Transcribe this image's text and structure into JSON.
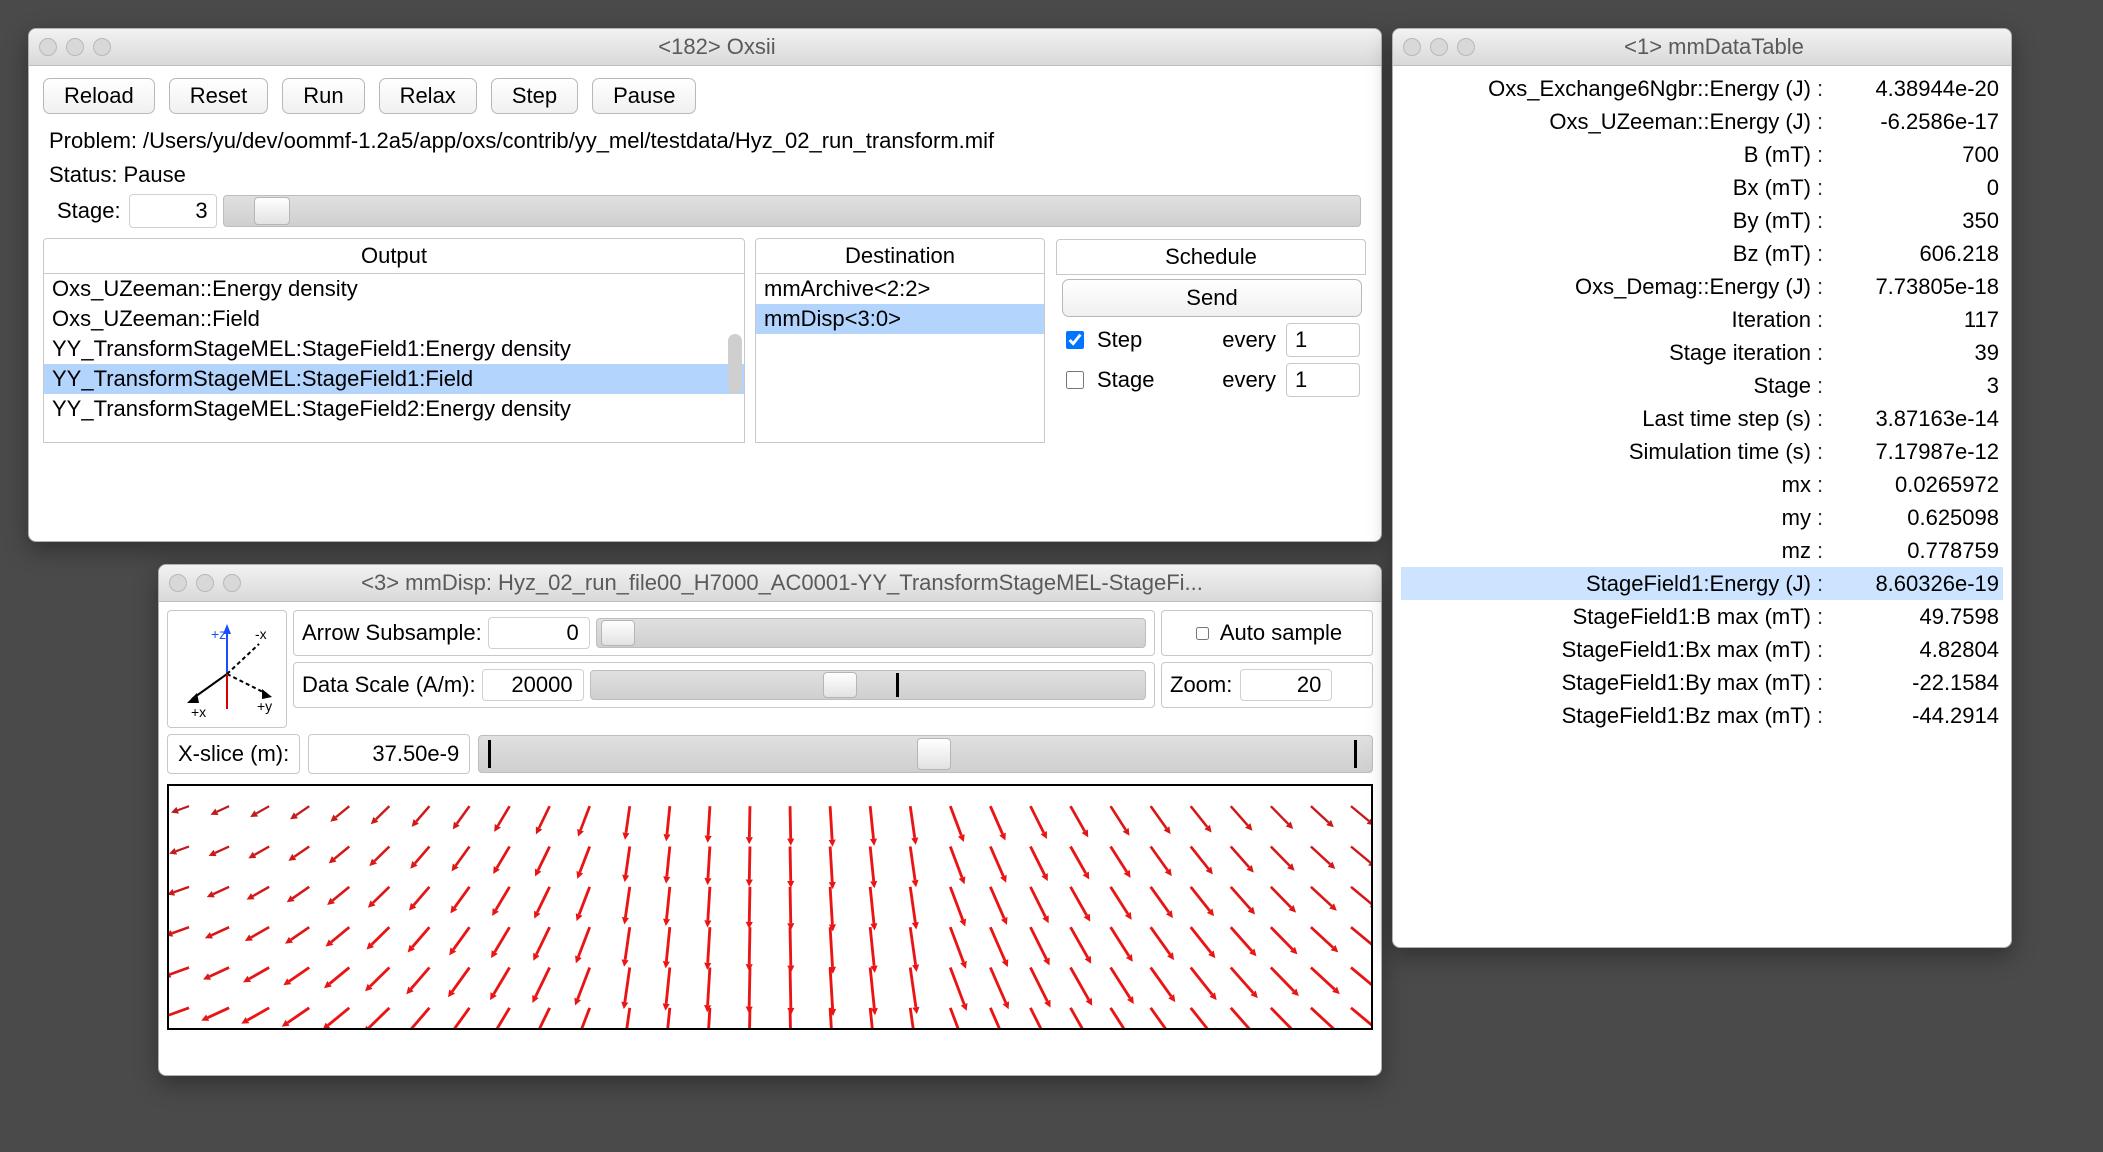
{
  "oxsii": {
    "title": "<182>  Oxsii",
    "buttons": {
      "reload": "Reload",
      "reset": "Reset",
      "run": "Run",
      "relax": "Relax",
      "step": "Step",
      "pause": "Pause"
    },
    "problem_label": "Problem:",
    "problem_value": "/Users/yu/dev/oommf-1.2a5/app/oxs/contrib/yy_mel/testdata/Hyz_02_run_transform.mif",
    "status_label": "Status:",
    "status_value": "Pause",
    "stage_label": "Stage:",
    "stage_value": "3",
    "headers": {
      "output": "Output",
      "destination": "Destination",
      "schedule": "Schedule"
    },
    "outputs": [
      {
        "label": "Oxs_UZeeman::Energy density",
        "selected": false
      },
      {
        "label": "Oxs_UZeeman::Field",
        "selected": false
      },
      {
        "label": "YY_TransformStageMEL:StageField1:Energy density",
        "selected": false
      },
      {
        "label": "YY_TransformStageMEL:StageField1:Field",
        "selected": true
      },
      {
        "label": "YY_TransformStageMEL:StageField2:Energy density",
        "selected": false
      }
    ],
    "destinations": [
      {
        "label": "mmArchive<2:2>",
        "selected": false
      },
      {
        "label": "mmDisp<3:0>",
        "selected": true
      }
    ],
    "schedule": {
      "send": "Send",
      "step_label": "Step",
      "step_checked": true,
      "step_every_label": "every",
      "step_every_value": "1",
      "stage_label": "Stage",
      "stage_checked": false,
      "stage_every_label": "every",
      "stage_every_value": "1"
    }
  },
  "mmdisp": {
    "title": "<3> mmDisp: Hyz_02_run_file00_H7000_AC0001-YY_TransformStageMEL-StageFi...",
    "arrow_subsample_label": "Arrow Subsample:",
    "arrow_subsample_value": "0",
    "auto_sample_label": "Auto sample",
    "auto_sample_checked": false,
    "data_scale_label": "Data Scale (A/m):",
    "data_scale_value": "20000",
    "zoom_label": "Zoom:",
    "zoom_value": "20",
    "xslice_label": "X-slice (m):",
    "xslice_value": "37.50e-9"
  },
  "mmdt": {
    "title": "<1>  mmDataTable",
    "rows": [
      {
        "k": "Oxs_Exchange6Ngbr::Energy (J)",
        "v": "4.38944e-20",
        "hl": false
      },
      {
        "k": "Oxs_UZeeman::Energy (J)",
        "v": "-6.2586e-17",
        "hl": false
      },
      {
        "k": "B (mT)",
        "v": "700",
        "hl": false
      },
      {
        "k": "Bx (mT)",
        "v": "0",
        "hl": false
      },
      {
        "k": "By (mT)",
        "v": "350",
        "hl": false
      },
      {
        "k": "Bz (mT)",
        "v": "606.218",
        "hl": false
      },
      {
        "k": "Oxs_Demag::Energy (J)",
        "v": "7.73805e-18",
        "hl": false
      },
      {
        "k": "Iteration",
        "v": "117",
        "hl": false
      },
      {
        "k": "Stage iteration",
        "v": "39",
        "hl": false
      },
      {
        "k": "Stage",
        "v": "3",
        "hl": false
      },
      {
        "k": "Last time step (s)",
        "v": "3.87163e-14",
        "hl": false
      },
      {
        "k": "Simulation time (s)",
        "v": "7.17987e-12",
        "hl": false
      },
      {
        "k": "mx",
        "v": "0.0265972",
        "hl": false
      },
      {
        "k": "my",
        "v": "0.625098",
        "hl": false
      },
      {
        "k": "mz",
        "v": "0.778759",
        "hl": false
      },
      {
        "k": "StageField1:Energy (J)",
        "v": "8.60326e-19",
        "hl": true
      },
      {
        "k": "StageField1:B max (mT)",
        "v": "49.7598",
        "hl": false
      },
      {
        "k": "StageField1:Bx max (mT)",
        "v": "4.82804",
        "hl": false
      },
      {
        "k": "StageField1:By max (mT)",
        "v": "-22.1584",
        "hl": false
      },
      {
        "k": "StageField1:Bz max (mT)",
        "v": "-44.2914",
        "hl": false
      }
    ]
  }
}
